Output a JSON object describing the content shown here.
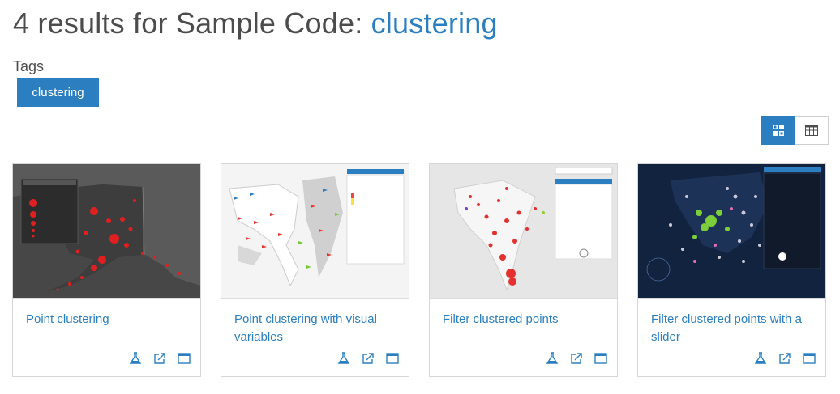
{
  "header": {
    "title_prefix": "4 results for Sample Code: ",
    "query": "clustering"
  },
  "tags": {
    "label": "Tags",
    "items": [
      "clustering"
    ]
  },
  "view_toggle": {
    "active": "grid"
  },
  "cards": [
    {
      "title": "Point clustering",
      "thumbnail": "dark-gray-alaska-earthquake-clusters"
    },
    {
      "title": "Point clustering with visual variables",
      "thumbnail": "world-map-wind-arrows"
    },
    {
      "title": "Filter clustered points",
      "thumbnail": "light-gray-india-clusters"
    },
    {
      "title": "Filter clustered points with a slider",
      "thumbnail": "dark-blue-europe-clusters"
    }
  ],
  "card_actions": [
    "flask-icon",
    "share-icon",
    "window-icon"
  ],
  "colors": {
    "accent": "#2b7fc0",
    "text": "#4c4c4c"
  }
}
